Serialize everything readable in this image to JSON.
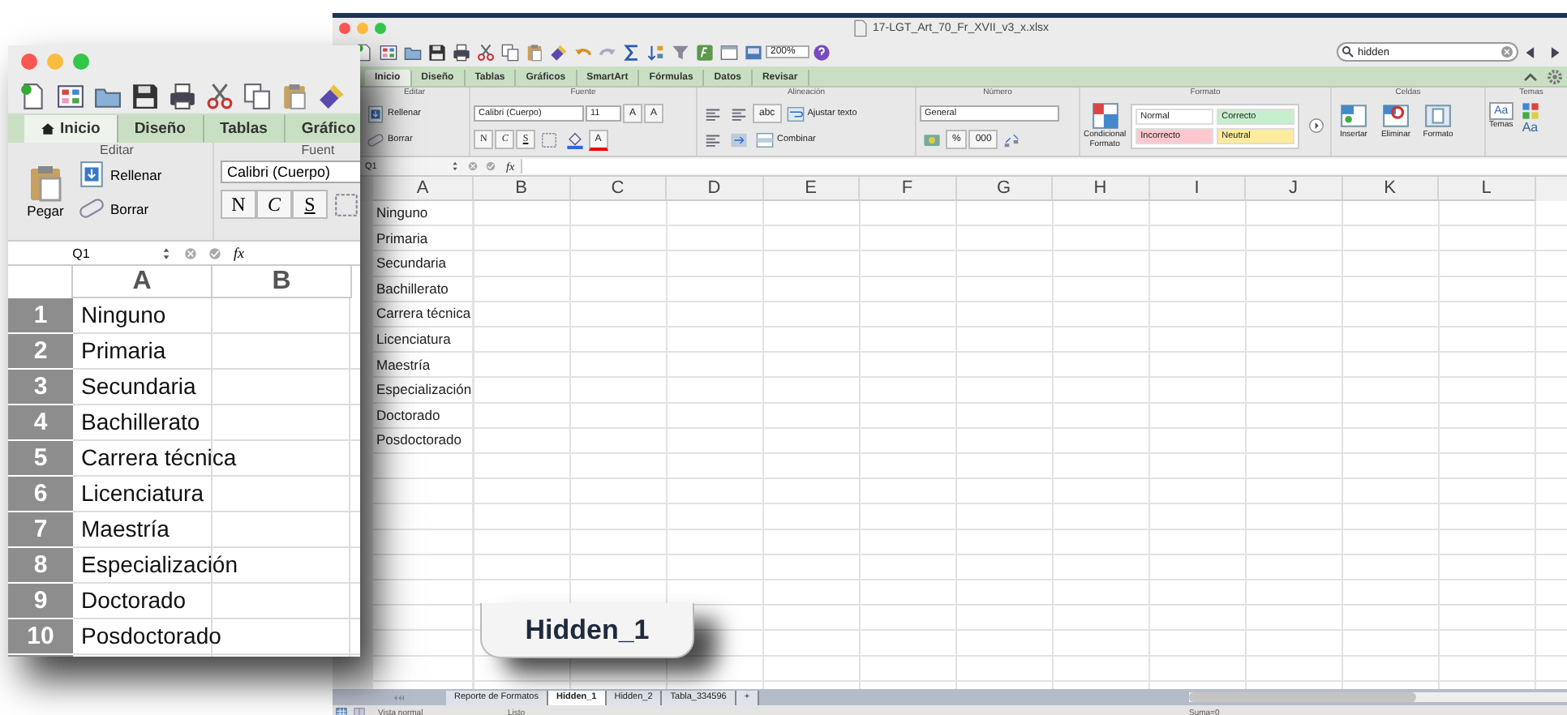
{
  "main_window": {
    "title": "17-LGT_Art_70_Fr_XVII_v3_x.xlsx",
    "zoom": "200%",
    "search": {
      "value": "hidden"
    },
    "tabs": [
      {
        "label": "Inicio",
        "selected": true
      },
      {
        "label": "Diseño",
        "selected": false
      },
      {
        "label": "Tablas",
        "selected": false
      },
      {
        "label": "Gráficos",
        "selected": false
      },
      {
        "label": "SmartArt",
        "selected": false
      },
      {
        "label": "Fórmulas",
        "selected": false
      },
      {
        "label": "Datos",
        "selected": false
      },
      {
        "label": "Revisar",
        "selected": false
      }
    ],
    "ribbon": [
      {
        "kind": "edit",
        "title": "Editar",
        "fill": "Rellenar",
        "clear": "Borrar"
      },
      {
        "kind": "font",
        "title": "Fuente",
        "font": "Calibri (Cuerpo)",
        "size": "11",
        "bold": "N",
        "italic": "C",
        "underline": "S",
        "grow": "A",
        "shrink": "A",
        "font_color_button": "A"
      },
      {
        "kind": "align",
        "title": "Alineación",
        "orient": "abc",
        "wrap": "Ajustar texto",
        "merge": "Combinar"
      },
      {
        "kind": "number",
        "title": "Número",
        "format": "General",
        "percent": "%",
        "thousands": "000"
      },
      {
        "kind": "format",
        "title": "Formato",
        "conditional": "Condicional Formato",
        "styles": [
          {
            "label": "Normal",
            "color": "#ffffff"
          },
          {
            "label": "Correcto",
            "color": "#c6efce"
          },
          {
            "label": "Incorrecto",
            "color": "#ffc7ce"
          },
          {
            "label": "Neutral",
            "color": "#ffeb9c"
          }
        ]
      },
      {
        "kind": "cells",
        "title": "Celdas",
        "buttons": [
          "Insertar",
          "Eliminar",
          "Formato"
        ]
      },
      {
        "kind": "themes",
        "title": "Temas",
        "button": "Temas",
        "preview": "Aa",
        "fonts": "Aa"
      }
    ],
    "name_box": "Q1",
    "formula_label": "fx",
    "columns": [
      "A",
      "B",
      "C",
      "D",
      "E",
      "F",
      "G",
      "H",
      "I",
      "J",
      "K",
      "L"
    ],
    "rows": [
      "Ninguno",
      "Primaria",
      "Secundaria",
      "Bachillerato",
      "Carrera técnica",
      "Licenciatura",
      "Maestría",
      "Especialización",
      "Doctorado",
      "Posdoctorado"
    ],
    "sheet_tabs": [
      {
        "label": "Reporte de Formatos",
        "selected": false
      },
      {
        "label": "Hidden_1",
        "selected": true
      },
      {
        "label": "Hidden_2",
        "selected": false
      },
      {
        "label": "Tabla_334596",
        "selected": false
      }
    ],
    "add_sheet": "+",
    "status_bar": {
      "view": "Vista normal",
      "state": "Listo",
      "sum": "Suma=0"
    }
  },
  "zoom_inset": {
    "tabs": [
      {
        "label": "Inicio",
        "selected": true
      },
      {
        "label": "Diseño",
        "selected": false
      },
      {
        "label": "Tablas",
        "selected": false
      },
      {
        "label": "Gráfico",
        "selected": false
      }
    ],
    "ribbon": {
      "edit_title": "Editar",
      "font_title": "Fuent",
      "paste": "Pegar",
      "fill": "Rellenar",
      "clear": "Borrar",
      "font": "Calibri (Cuerpo)",
      "bold": "N",
      "italic": "C",
      "underline": "S"
    },
    "name_box": "Q1",
    "formula_label": "fx",
    "columns": [
      "A",
      "B"
    ],
    "rows": [
      {
        "number": "1",
        "value": "Ninguno"
      },
      {
        "number": "2",
        "value": "Primaria"
      },
      {
        "number": "3",
        "value": "Secundaria"
      },
      {
        "number": "4",
        "value": "Bachillerato"
      },
      {
        "number": "5",
        "value": "Carrera técnica"
      },
      {
        "number": "6",
        "value": "Licenciatura"
      },
      {
        "number": "7",
        "value": "Maestría"
      },
      {
        "number": "8",
        "value": "Especialización"
      },
      {
        "number": "9",
        "value": "Doctorado"
      },
      {
        "number": "10",
        "value": "Posdoctorado"
      }
    ]
  },
  "zoomed_tab": {
    "label": "Hidden_1"
  }
}
